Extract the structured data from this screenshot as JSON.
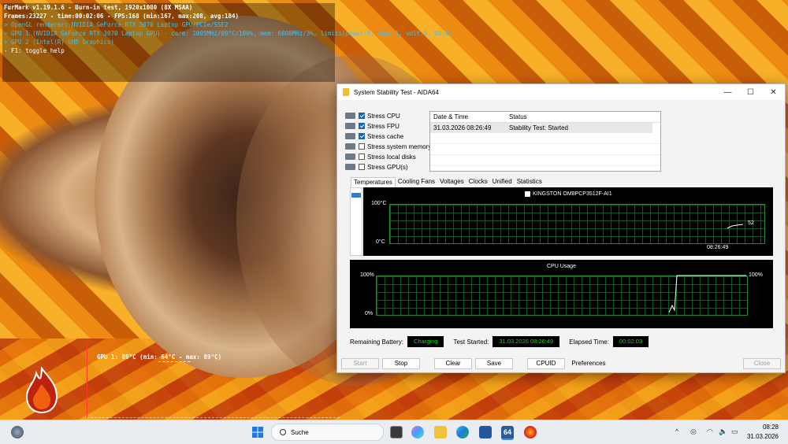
{
  "furmark": {
    "osd": [
      "FurMark v1.19.1.6 - Burn-in test, 1920x1080 (8X MSAA)",
      "Frames:23227 - time:00:02:06 - FPS:168 (min:167, max:208, avg:184)",
      "> OpenGL renderer: NVIDIA GeForce RTX 3070 Laptop GPU/PCIe/SSE2",
      "> GPU 1 (NVIDIA GeForce RTX 3070 Laptop GPU) - core: 1095MHz/89°C/100%, mem: 6000MHz/3%, limits[power:0, temp:1, volt:0, OV:0]",
      "> GPU 2 (Intel(R) UHD Graphics)",
      "- F1: toggle help"
    ],
    "gpu_temp_label": "GPU 1: 89°C (min: 64°C - max: 89°C)"
  },
  "window": {
    "title": "System Stability Test - AIDA64",
    "controls": {
      "minimize": "—",
      "maximize": "☐",
      "close": "✕"
    },
    "stress_options": [
      {
        "label": "Stress CPU",
        "checked": true,
        "icon": "cpu-icon"
      },
      {
        "label": "Stress FPU",
        "checked": true,
        "icon": "fpu-icon"
      },
      {
        "label": "Stress cache",
        "checked": true,
        "icon": "cache-icon"
      },
      {
        "label": "Stress system memory",
        "checked": false,
        "icon": "memory-icon"
      },
      {
        "label": "Stress local disks",
        "checked": false,
        "icon": "disk-icon"
      },
      {
        "label": "Stress GPU(s)",
        "checked": false,
        "icon": "gpu-icon"
      }
    ],
    "log": {
      "headers": [
        "Date & Time",
        "Status"
      ],
      "rows": [
        [
          "31.03.2026 08:26:49",
          "Stability Test: Started"
        ]
      ]
    },
    "tabs": [
      "Temperatures",
      "Cooling Fans",
      "Voltages",
      "Clocks",
      "Unified",
      "Statistics"
    ],
    "active_tab": "Temperatures",
    "temp_graph": {
      "legend": "KINGSTON OM8PCP3512F-AI1",
      "y_max": "100°C",
      "y_min": "0°C",
      "time": "08:26:49",
      "value": "52"
    },
    "cpu_graph": {
      "title": "CPU Usage",
      "y_max": "100%",
      "y_min": "0%",
      "value": "100%"
    },
    "status_bar": {
      "battery_label": "Remaining Battery:",
      "battery_value": "Charging",
      "started_label": "Test Started:",
      "started_value": "31.03.2026 08:26:49",
      "elapsed_label": "Elapsed Time:",
      "elapsed_value": "00:02:03"
    },
    "buttons": {
      "start": "Start",
      "stop": "Stop",
      "clear": "Clear",
      "save": "Save",
      "cpuid": "CPUID",
      "preferences": "Preferences",
      "close": "Close"
    }
  },
  "taskbar": {
    "search_placeholder": "Suche",
    "time": "08:28",
    "date": "31.03.2026",
    "tray_chevron": "^",
    "aida_label": "64"
  },
  "colors": {
    "graph_green": "#19d019",
    "lcd_green": "#19d019",
    "check_blue": "#1a63b0",
    "osd_cyan": "#3fc0f0"
  }
}
